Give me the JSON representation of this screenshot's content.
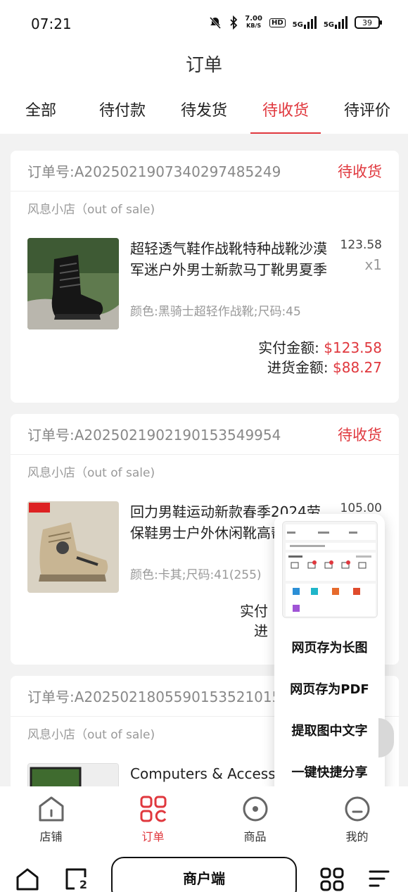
{
  "status_bar": {
    "time": "07:21",
    "net_speed_value": "7.00",
    "net_speed_unit": "KB/S",
    "hd_label": "HD",
    "signal1": "5G",
    "signal2": "5G",
    "battery": "39"
  },
  "header": {
    "title": "订单",
    "tabs": [
      {
        "label": "全部"
      },
      {
        "label": "待付款"
      },
      {
        "label": "待发货"
      },
      {
        "label": "待收货",
        "active": true
      },
      {
        "label": "待评价"
      }
    ]
  },
  "orders": [
    {
      "order_no": "订单号:A2025021907340297485249",
      "status": "待收货",
      "shop": "风息小店（out of sale)",
      "goods_title": "超轻透气鞋作战靴特种战靴沙漠军迷户外男士新款马丁靴男夏季",
      "spec": "颜色:黑骑士超轻作战靴;尺码:45",
      "price": "123.58",
      "qty": "x1",
      "paid_label": "实付金额:",
      "paid_value": "$123.58",
      "purchase_label": "进货金额:",
      "purchase_value": "$88.27"
    },
    {
      "order_no": "订单号:A2025021902190153549954",
      "status": "待收货",
      "shop": "风息小店（out of sale)",
      "goods_title": "回力男鞋运动新款春季2024劳保鞋男士户外休闲靴高帮马丁靴",
      "spec": "颜色:卡其;尺码:41(255)",
      "price": "105.00",
      "paid_label_partial": "实付",
      "purchase_label_partial": "进"
    },
    {
      "order_no": "订单号:A2025021805590153521015",
      "shop": "风息小店（out of sale)",
      "goods_title": "Computers & Accesso"
    }
  ],
  "float_menu": {
    "items": [
      {
        "label": "网页存为长图"
      },
      {
        "label": "网页存为PDF"
      },
      {
        "label": "提取图中文字"
      },
      {
        "label": "一键快捷分享"
      }
    ]
  },
  "tabbar": {
    "items": [
      {
        "label": "店铺",
        "icon": "store-icon"
      },
      {
        "label": "订单",
        "icon": "orders-icon",
        "active": true
      },
      {
        "label": "商品",
        "icon": "goods-icon"
      },
      {
        "label": "我的",
        "icon": "profile-icon"
      }
    ]
  },
  "sysnav": {
    "client_label": "商户端",
    "recent_badge": "2"
  },
  "colors": {
    "accent": "#e0383e",
    "text": "#222222",
    "muted": "#999999",
    "bg": "#f2f2f2"
  }
}
